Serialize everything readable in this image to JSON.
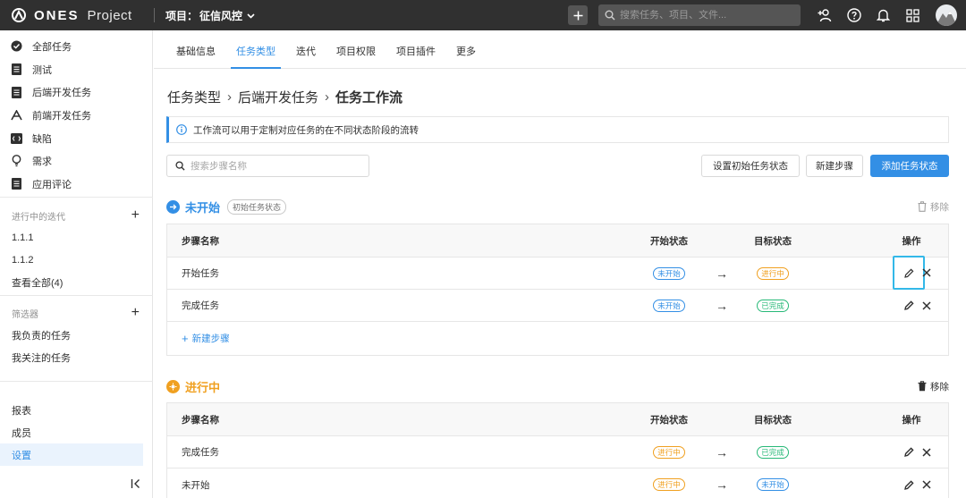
{
  "topbar": {
    "brand_name": "ONES",
    "brand_product": "Project",
    "project_label": "项目：",
    "project_name": "征信风控",
    "search_placeholder": "搜索任务、项目、文件..."
  },
  "sidebar": {
    "items": [
      {
        "label": "全部任务",
        "icon": "check-circle-icon"
      },
      {
        "label": "测试",
        "icon": "doc-icon"
      },
      {
        "label": "后端开发任务",
        "icon": "doc-icon"
      },
      {
        "label": "前端开发任务",
        "icon": "code-icon"
      },
      {
        "label": "缺陷",
        "icon": "bug-icon"
      },
      {
        "label": "需求",
        "icon": "bulb-icon"
      },
      {
        "label": "应用评论",
        "icon": "doc-icon"
      }
    ],
    "iterations_title": "进行中的迭代",
    "iterations": [
      "1.1.1",
      "1.1.2",
      "查看全部(4)"
    ],
    "filters_title": "筛选器",
    "filters": [
      "我负责的任务",
      "我关注的任务"
    ],
    "bottom": [
      "报表",
      "成员",
      "设置"
    ]
  },
  "tabs": [
    "基础信息",
    "任务类型",
    "迭代",
    "项目权限",
    "项目插件",
    "更多"
  ],
  "active_tab": 1,
  "breadcrumb": [
    "任务类型",
    "后端开发任务",
    "任务工作流"
  ],
  "info_text": "工作流可以用于定制对应任务的在不同状态阶段的流转",
  "step_search_placeholder": "搜索步骤名称",
  "buttons": {
    "set_initial": "设置初始任务状态",
    "new_step": "新建步骤",
    "add_status": "添加任务状态"
  },
  "table_headers": {
    "name": "步骤名称",
    "start": "开始状态",
    "target": "目标状态",
    "op": "操作"
  },
  "remove_label": "移除",
  "add_step_label": "新建步骤",
  "sections": [
    {
      "name": "未开始",
      "color": "#338fe5",
      "tag": "初始任务状态",
      "rows": [
        {
          "name": "开始任务",
          "start": "未开始",
          "start_color": "blue",
          "target": "进行中",
          "target_color": "orange"
        },
        {
          "name": "完成任务",
          "start": "未开始",
          "start_color": "blue",
          "target": "已完成",
          "target_color": "green"
        }
      ]
    },
    {
      "name": "进行中",
      "color": "#f0a020",
      "rows": [
        {
          "name": "完成任务",
          "start": "进行中",
          "start_color": "orange",
          "target": "已完成",
          "target_color": "green"
        },
        {
          "name": "未开始",
          "start": "进行中",
          "start_color": "orange",
          "target": "未开始",
          "target_color": "blue"
        }
      ]
    }
  ]
}
